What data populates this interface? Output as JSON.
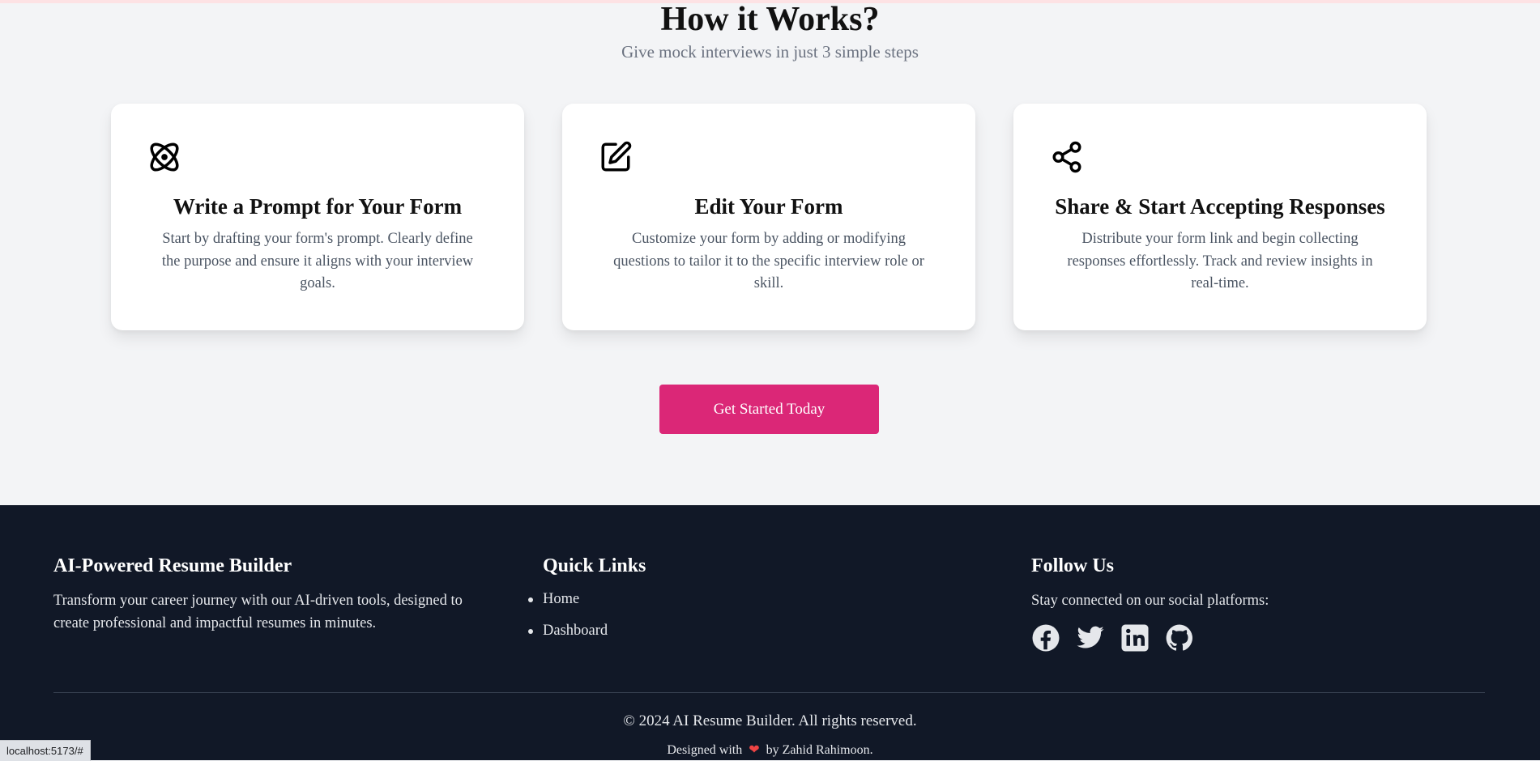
{
  "how": {
    "title": "How it Works?",
    "subtitle": "Give mock interviews in just 3 simple steps"
  },
  "steps": [
    {
      "icon": "atom-icon",
      "title": "Write a Prompt for Your Form",
      "description": "Start by drafting your form's prompt. Clearly define the purpose and ensure it aligns with your interview goals."
    },
    {
      "icon": "edit-icon",
      "title": "Edit Your Form",
      "description": "Customize your form by adding or modifying questions to tailor it to the specific interview role or skill."
    },
    {
      "icon": "share-icon",
      "title": "Share & Start Accepting Responses",
      "description": "Distribute your form link and begin collecting responses effortlessly. Track and review insights in real-time."
    }
  ],
  "cta": {
    "label": "Get Started Today"
  },
  "footer": {
    "about": {
      "title": "AI-Powered Resume Builder",
      "text": "Transform your career journey with our AI-driven tools, designed to create professional and impactful resumes in minutes."
    },
    "links": {
      "title": "Quick Links",
      "items": [
        "Home",
        "Dashboard"
      ]
    },
    "social": {
      "title": "Follow Us",
      "text": "Stay connected on our social platforms:",
      "icons": [
        "facebook-icon",
        "twitter-icon",
        "linkedin-icon",
        "github-icon"
      ]
    },
    "copyright": "© 2024 AI Resume Builder. All rights reserved.",
    "designed_prefix": "Designed with",
    "designed_suffix": "by Zahid Rahimoon."
  },
  "status_url": "localhost:5173/#",
  "colors": {
    "accent": "#db2777",
    "footer_bg": "#111827",
    "page_bg": "#f3f4f6"
  }
}
